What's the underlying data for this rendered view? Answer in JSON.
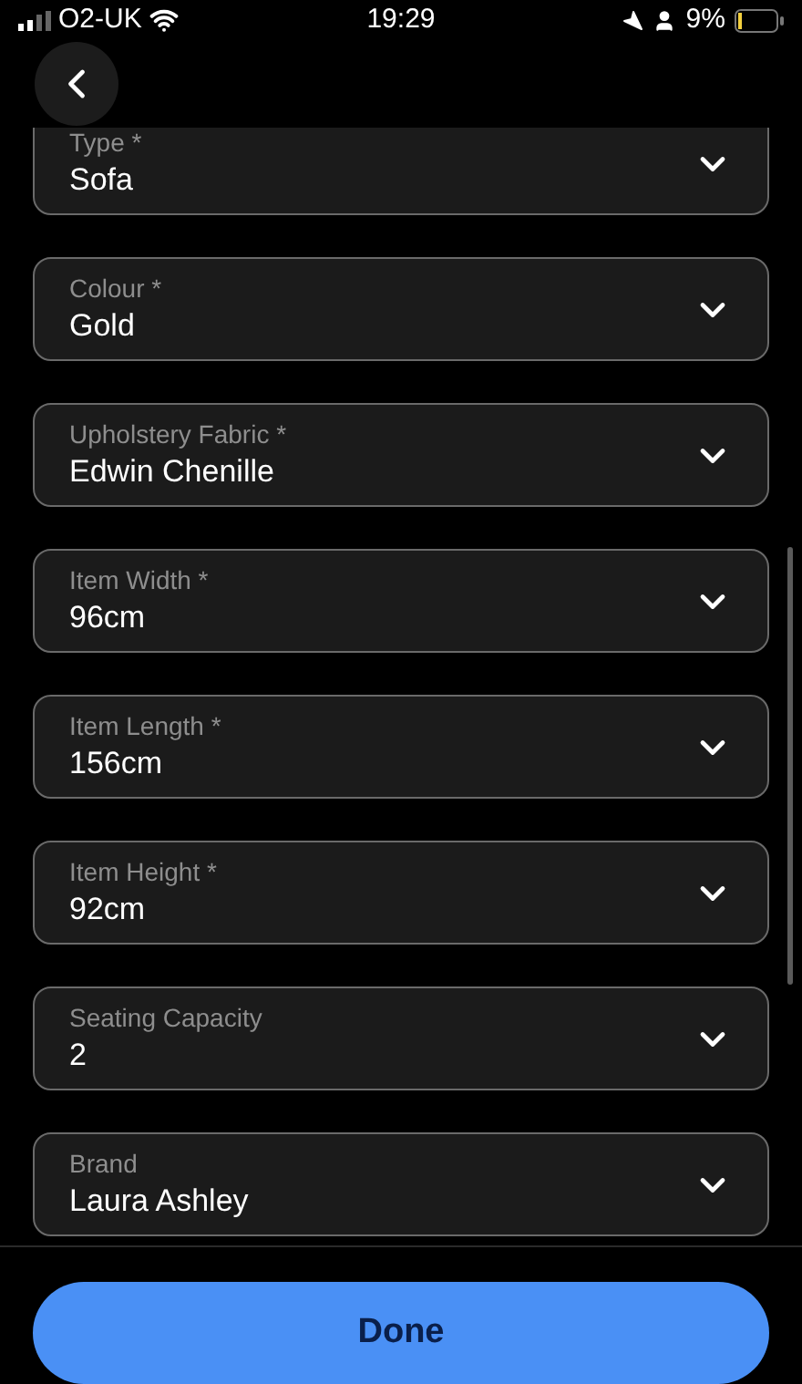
{
  "status_bar": {
    "carrier": "O2-UK",
    "time": "19:29",
    "battery": "9%"
  },
  "fields": [
    {
      "label": "Type *",
      "value": "Sofa"
    },
    {
      "label": "Colour *",
      "value": "Gold"
    },
    {
      "label": "Upholstery Fabric *",
      "value": "Edwin Chenille"
    },
    {
      "label": "Item Width *",
      "value": "96cm"
    },
    {
      "label": "Item Length *",
      "value": "156cm"
    },
    {
      "label": "Item Height *",
      "value": "92cm"
    },
    {
      "label": "Seating Capacity",
      "value": "2"
    },
    {
      "label": "Brand",
      "value": "Laura Ashley"
    }
  ],
  "done_button": "Done"
}
